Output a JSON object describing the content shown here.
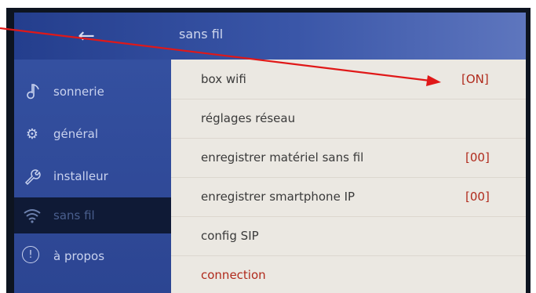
{
  "header": {
    "back_icon": "left-arrow-icon",
    "back_glyph": "←",
    "title": "sans fil"
  },
  "sidebar": {
    "items": [
      {
        "label": "sonnerie",
        "icon": "music-note-icon",
        "glyph": "♪"
      },
      {
        "label": "général",
        "icon": "gear-icon",
        "glyph": "⚙"
      },
      {
        "label": "installeur",
        "icon": "wrench-icon",
        "glyph": "🔧"
      },
      {
        "label": "sans fil",
        "icon": "wifi-icon",
        "glyph": "",
        "active": true
      },
      {
        "label": "à propos",
        "icon": "info-icon",
        "glyph": "!"
      }
    ]
  },
  "settings": {
    "rows": [
      {
        "label": "box wifi",
        "value": "[ON]"
      },
      {
        "label": "réglages réseau",
        "value": ""
      },
      {
        "label": "enregistrer matériel sans fil",
        "value": "[00]"
      },
      {
        "label": "enregistrer smartphone IP",
        "value": "[00]"
      },
      {
        "label": "config SIP",
        "value": ""
      },
      {
        "label": "connection",
        "value": ""
      }
    ]
  },
  "colors": {
    "accent_blue": "#2c4592",
    "value_red": "#b02a1c",
    "annotation_arrow": "#e01818"
  }
}
